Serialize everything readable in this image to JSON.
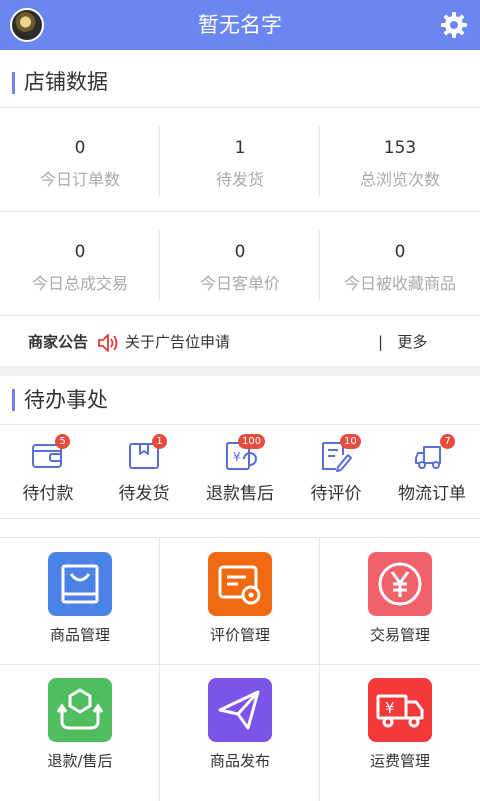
{
  "header": {
    "title": "暂无名字",
    "avatar_icon": "avatar",
    "settings_icon": "gear-icon",
    "color": "#6c86f1"
  },
  "store_section": {
    "title": "店铺数据"
  },
  "stats": [
    {
      "value": "0",
      "label": "今日订单数"
    },
    {
      "value": "1",
      "label": "待发货"
    },
    {
      "value": "153",
      "label": "总浏览次数"
    },
    {
      "value": "0",
      "label": "今日总成交易"
    },
    {
      "value": "0",
      "label": "今日客单价"
    },
    {
      "value": "0",
      "label": "今日被收藏商品"
    }
  ],
  "notice": {
    "label": "商家公告",
    "text": "关于广告位申请",
    "divider": "|",
    "more": "更多"
  },
  "todo_section": {
    "title": "待办事处"
  },
  "todos": [
    {
      "label": "待付款",
      "badge": "5",
      "icon": "wallet-icon"
    },
    {
      "label": "待发货",
      "badge": "1",
      "icon": "package-icon"
    },
    {
      "label": "退款售后",
      "badge": "100",
      "icon": "refund-icon"
    },
    {
      "label": "待评价",
      "badge": "10",
      "icon": "review-icon"
    },
    {
      "label": "物流订单",
      "badge": "7",
      "icon": "truck-icon"
    }
  ],
  "tiles": [
    {
      "label": "商品管理",
      "color": "#4a82e8",
      "icon": "shopping-bag-icon"
    },
    {
      "label": "评价管理",
      "color": "#f06a12",
      "icon": "review-settings-icon"
    },
    {
      "label": "交易管理",
      "color": "#f0626a",
      "icon": "yen-coin-icon"
    },
    {
      "label": "退款/售后",
      "color": "#4fbe5e",
      "icon": "return-box-icon"
    },
    {
      "label": "商品发布",
      "color": "#7b55e8",
      "icon": "paper-plane-icon"
    },
    {
      "label": "运费管理",
      "color": "#f23a3a",
      "icon": "freight-truck-icon"
    }
  ]
}
